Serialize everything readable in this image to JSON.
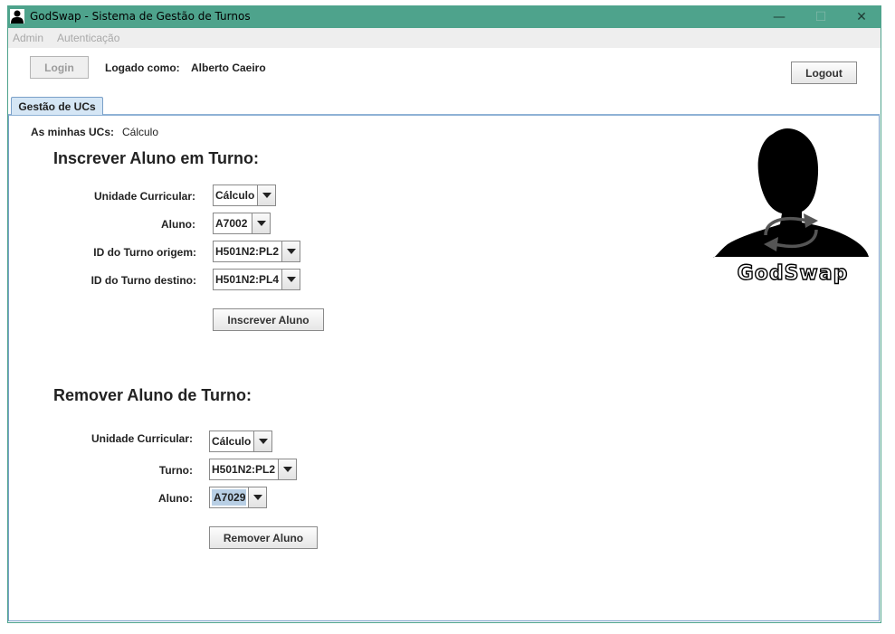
{
  "window": {
    "title": "GodSwap - Sistema de Gestão de Turnos",
    "controls": {
      "minimize": "—",
      "maximize": "☐",
      "close": "✕"
    },
    "accent_color": "#4ea38c"
  },
  "menu": {
    "items": [
      "Admin",
      "Autenticação"
    ]
  },
  "header": {
    "login_label": "Login",
    "logged_as_label": "Logado como:",
    "user_name": "Alberto Caeiro",
    "logout_label": "Logout"
  },
  "tabs": [
    {
      "label": "Gestão de UCs",
      "active": true
    }
  ],
  "my_ucs": {
    "label": "As minhas UCs:",
    "value": "Cálculo"
  },
  "enroll": {
    "title": "Inscrever Aluno em Turno:",
    "fields": [
      {
        "label": "Unidade Curricular:",
        "value": "Cálculo"
      },
      {
        "label": "Aluno:",
        "value": "A7002"
      },
      {
        "label": "ID do Turno origem:",
        "value": "H501N2:PL2"
      },
      {
        "label": "ID do Turno destino:",
        "value": "H501N2:PL4"
      }
    ],
    "button": "Inscrever Aluno"
  },
  "remove": {
    "title": "Remover Aluno de Turno:",
    "fields": [
      {
        "label": "Unidade Curricular:",
        "value": "Cálculo"
      },
      {
        "label": "Turno:",
        "value": "H501N2:PL2"
      },
      {
        "label": "Aluno:",
        "value": "A7029"
      }
    ],
    "button": "Remover Aluno"
  },
  "logo": {
    "icon": "person-swap-icon",
    "text": "GodSwap"
  }
}
